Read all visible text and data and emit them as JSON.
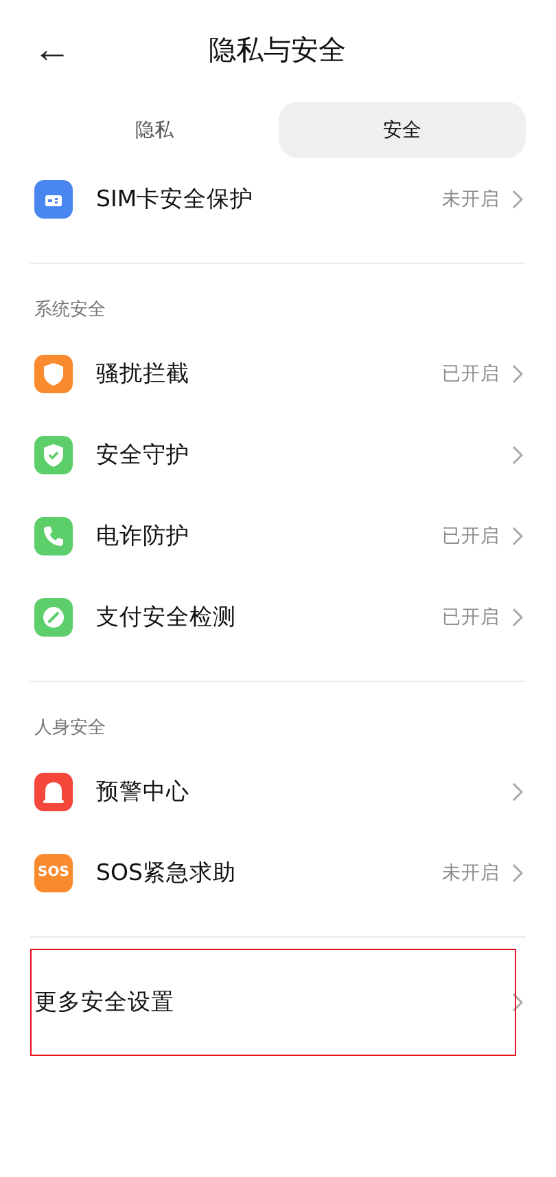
{
  "header": {
    "back": "←",
    "title": "隐私与安全"
  },
  "tabs": [
    {
      "label": "隐私",
      "selected": false
    },
    {
      "label": "安全",
      "selected": true
    }
  ],
  "sections": [
    {
      "items": [
        {
          "kind": "sim",
          "color": "#4a86f0",
          "label": "SIM卡安全保护",
          "status": "未开启"
        }
      ]
    },
    {
      "title": "系统安全",
      "items": [
        {
          "kind": "shield",
          "color": "#fa8a2e",
          "label": "骚扰拦截",
          "status": "已开启"
        },
        {
          "kind": "shield-check",
          "color": "#5ccf6a",
          "label": "安全守护"
        },
        {
          "kind": "phone",
          "color": "#5ccf6a",
          "label": "电诈防护",
          "status": "已开启"
        },
        {
          "kind": "gauge",
          "color": "#5ccf6a",
          "label": "支付安全检测",
          "status": "已开启"
        }
      ]
    },
    {
      "title": "人身安全",
      "items": [
        {
          "kind": "bell",
          "color": "#f5473a",
          "label": "预警中心"
        },
        {
          "kind": "text",
          "color": "#fa8a2e",
          "icon_text": "SOS",
          "label": "SOS紧急求助",
          "status": "未开启"
        }
      ]
    },
    {
      "items": [
        {
          "kind": "none",
          "label": "更多安全设置",
          "highlighted": true
        }
      ]
    }
  ]
}
